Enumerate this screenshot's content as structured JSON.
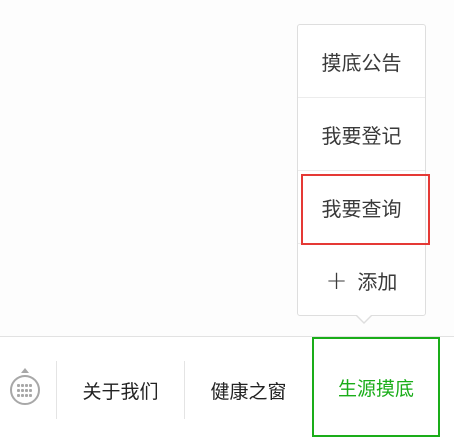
{
  "submenu": {
    "items": [
      {
        "label": "摸底公告"
      },
      {
        "label": "我要登记"
      },
      {
        "label": "我要查询"
      },
      {
        "label": "添加",
        "icon": "plus-icon"
      }
    ]
  },
  "menubar": {
    "toggle_icon": "keyboard-icon",
    "buttons": [
      {
        "label": "关于我们"
      },
      {
        "label": "健康之窗"
      },
      {
        "label": "生源摸底"
      }
    ]
  },
  "colors": {
    "accent": "#1aad19",
    "highlight": "#e53935",
    "text": "#222222"
  }
}
